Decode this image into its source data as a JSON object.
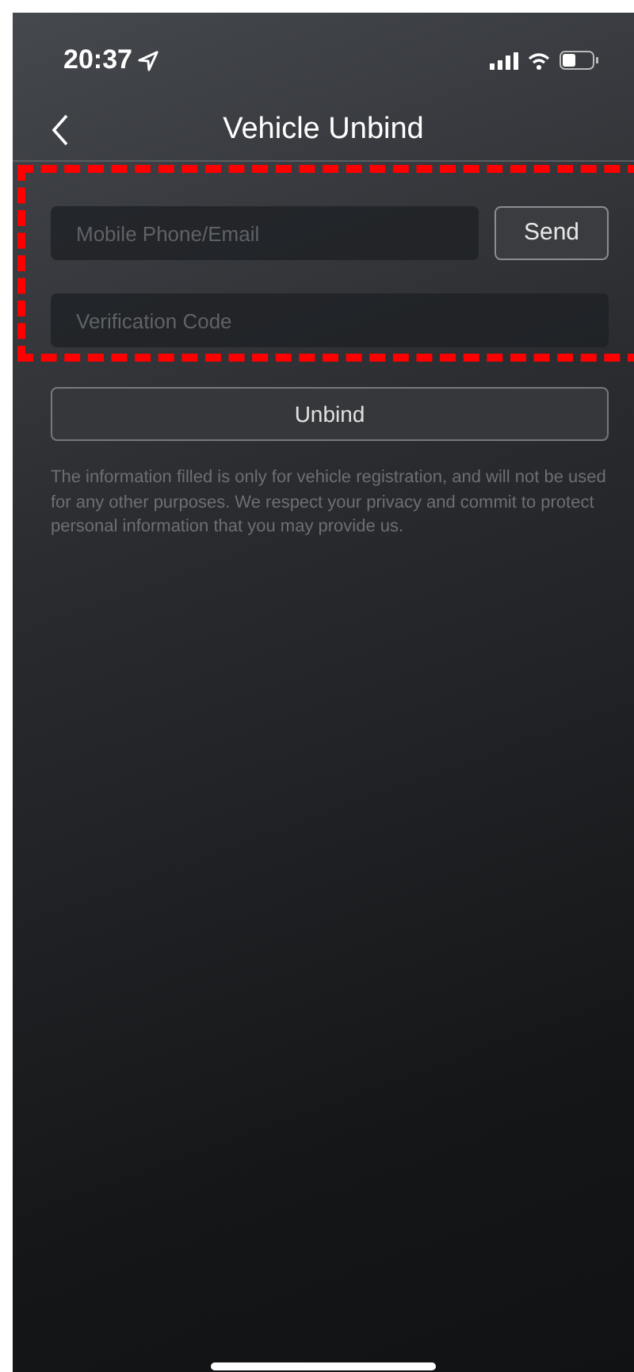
{
  "status_bar": {
    "time": "20:37"
  },
  "header": {
    "title": "Vehicle Unbind"
  },
  "form": {
    "contact_field": {
      "placeholder": "Mobile Phone/Email"
    },
    "send_button": "Send",
    "code_field": {
      "placeholder": "Verification Code"
    },
    "unbind_button": "Unbind"
  },
  "notice": "The information filled is only for vehicle registration, and will not be used for any other purposes. We respect your privacy and commit to protect personal information that you may provide us.",
  "annotation": {
    "kind": "dashed-frame",
    "color": "#ff0000"
  }
}
